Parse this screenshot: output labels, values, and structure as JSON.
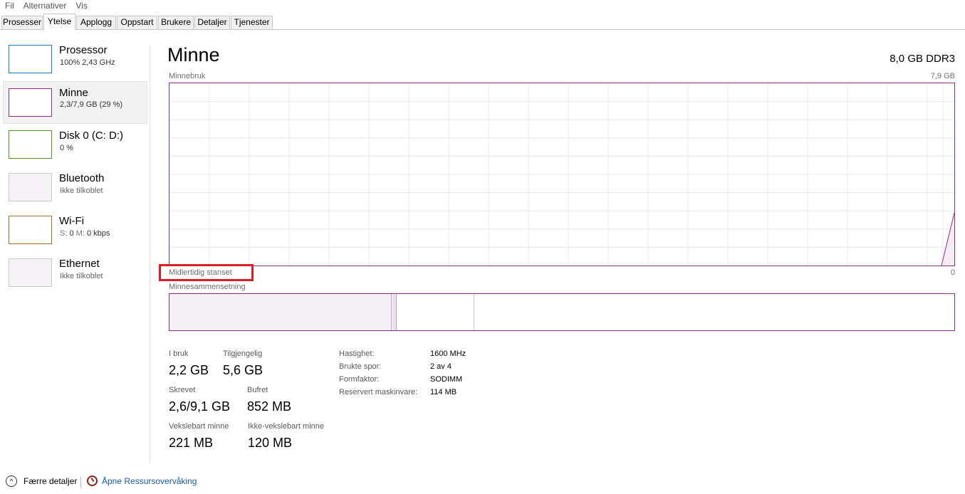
{
  "menu": [
    "Fil",
    "Alternativer",
    "Vis"
  ],
  "tabs": [
    "Prosesser",
    "Ytelse",
    "Applogg",
    "Oppstart",
    "Brukere",
    "Detaljer",
    "Tjenester"
  ],
  "active_tab": "Ytelse",
  "sidebar": {
    "items": [
      {
        "title": "Prosessor",
        "sub": "100%  2,43 GHz",
        "color": "#1a7bb8"
      },
      {
        "title": "Minne",
        "sub": "2,3/7,9 GB (29 %)",
        "color": "#8b2f8b",
        "selected": true
      },
      {
        "title": "Disk 0 (C: D:)",
        "sub": "0 %",
        "color": "#4d9a1f"
      },
      {
        "title": "Bluetooth",
        "sub": "Ikke tilkoblet",
        "color": "#c9c9c9"
      },
      {
        "title": "Wi-Fi",
        "sub_prefix1": "S:",
        "sub_val1": "0",
        "sub_prefix2": "M:",
        "sub_val2": "0 kbps",
        "color": "#a86a2b"
      },
      {
        "title": "Ethernet",
        "sub": "Ikke tilkoblet",
        "color": "#c9c9c9"
      }
    ]
  },
  "main": {
    "title": "Minne",
    "spec": "8,0 GB DDR3",
    "usage_label": "Minnebruk",
    "usage_max": "7,9 GB",
    "usage_min": "0",
    "paused_label": "Midlertidig stanset",
    "composition_label": "Minnesammensetning"
  },
  "stats": {
    "in_use_label": "I bruk",
    "in_use": "2,2 GB",
    "available_label": "Tilgjengelig",
    "available": "5,6 GB",
    "committed_label": "Skrevet",
    "committed": "2,6/9,1 GB",
    "cached_label": "Bufret",
    "cached": "852 MB",
    "paged_label": "Vekslebart minne",
    "paged": "221 MB",
    "nonpaged_label": "Ikke-vekslebart minne",
    "nonpaged": "120 MB"
  },
  "hardware": [
    {
      "label": "Hastighet:",
      "value": "1600 MHz"
    },
    {
      "label": "Brukte spor:",
      "value": "2 av 4"
    },
    {
      "label": "Formfaktor:",
      "value": "SODIMM"
    },
    {
      "label": "Reservert maskinvare:",
      "value": "114 MB"
    }
  ],
  "footer": {
    "fewer_details": "Færre detaljer",
    "open_resmon": "Åpne Ressursovervåking"
  },
  "colors": {
    "memory_accent": "#8b2f8b",
    "highlight_box": "#e01b24",
    "in_use_fill": "#f4f0f4",
    "modified_fill": "#e6d6e6"
  }
}
